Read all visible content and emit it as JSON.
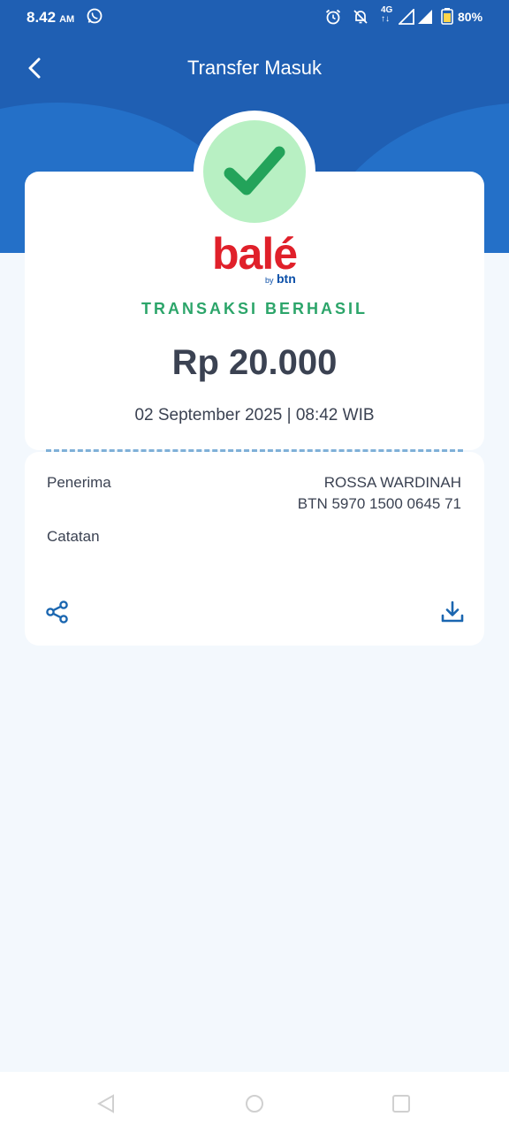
{
  "status_bar": {
    "time": "8.42",
    "ampm": "AM",
    "network": "4G",
    "battery": "80%"
  },
  "header": {
    "title": "Transfer Masuk"
  },
  "brand": {
    "logo_text": "balé",
    "by_text": "by",
    "sub_text": "btn"
  },
  "receipt": {
    "status": "TRANSAKSI BERHASIL",
    "amount": "Rp 20.000",
    "datetime": "02 September 2025 | 08:42 WIB"
  },
  "details": {
    "recipient_label": "Penerima",
    "recipient_name": "ROSSA WARDINAH",
    "recipient_account": "BTN 5970 1500 0645 71",
    "note_label": "Catatan"
  },
  "colors": {
    "header": "#1f5fb3",
    "success": "#2ca56a",
    "brand_red": "#e0202a",
    "accent": "#0b4fa8"
  },
  "icons": [
    "back-icon",
    "check-icon",
    "share-icon",
    "download-icon"
  ]
}
